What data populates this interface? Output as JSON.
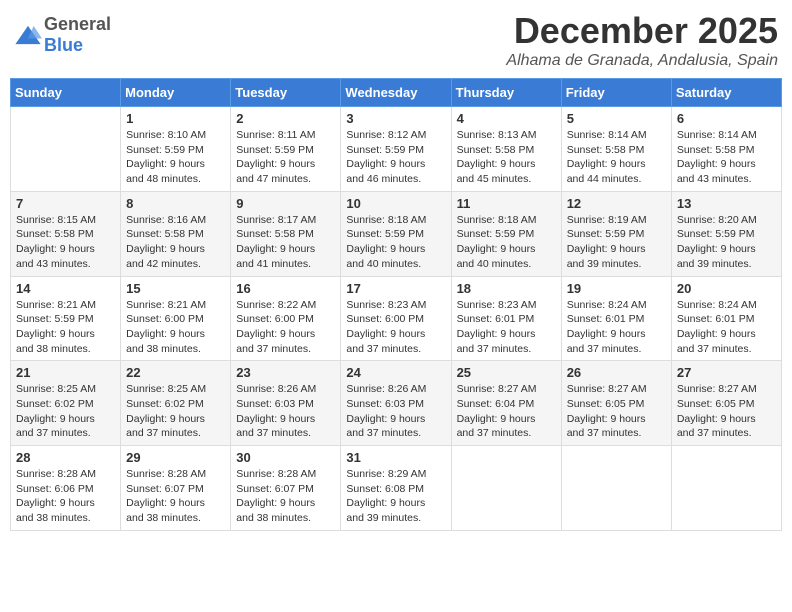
{
  "logo": {
    "general": "General",
    "blue": "Blue"
  },
  "title": "December 2025",
  "subtitle": "Alhama de Granada, Andalusia, Spain",
  "headers": [
    "Sunday",
    "Monday",
    "Tuesday",
    "Wednesday",
    "Thursday",
    "Friday",
    "Saturday"
  ],
  "weeks": [
    [
      {
        "day": "",
        "sunrise": "",
        "sunset": "",
        "daylight": ""
      },
      {
        "day": "1",
        "sunrise": "Sunrise: 8:10 AM",
        "sunset": "Sunset: 5:59 PM",
        "daylight": "Daylight: 9 hours and 48 minutes."
      },
      {
        "day": "2",
        "sunrise": "Sunrise: 8:11 AM",
        "sunset": "Sunset: 5:59 PM",
        "daylight": "Daylight: 9 hours and 47 minutes."
      },
      {
        "day": "3",
        "sunrise": "Sunrise: 8:12 AM",
        "sunset": "Sunset: 5:59 PM",
        "daylight": "Daylight: 9 hours and 46 minutes."
      },
      {
        "day": "4",
        "sunrise": "Sunrise: 8:13 AM",
        "sunset": "Sunset: 5:58 PM",
        "daylight": "Daylight: 9 hours and 45 minutes."
      },
      {
        "day": "5",
        "sunrise": "Sunrise: 8:14 AM",
        "sunset": "Sunset: 5:58 PM",
        "daylight": "Daylight: 9 hours and 44 minutes."
      },
      {
        "day": "6",
        "sunrise": "Sunrise: 8:14 AM",
        "sunset": "Sunset: 5:58 PM",
        "daylight": "Daylight: 9 hours and 43 minutes."
      }
    ],
    [
      {
        "day": "7",
        "sunrise": "Sunrise: 8:15 AM",
        "sunset": "Sunset: 5:58 PM",
        "daylight": "Daylight: 9 hours and 43 minutes."
      },
      {
        "day": "8",
        "sunrise": "Sunrise: 8:16 AM",
        "sunset": "Sunset: 5:58 PM",
        "daylight": "Daylight: 9 hours and 42 minutes."
      },
      {
        "day": "9",
        "sunrise": "Sunrise: 8:17 AM",
        "sunset": "Sunset: 5:58 PM",
        "daylight": "Daylight: 9 hours and 41 minutes."
      },
      {
        "day": "10",
        "sunrise": "Sunrise: 8:18 AM",
        "sunset": "Sunset: 5:59 PM",
        "daylight": "Daylight: 9 hours and 40 minutes."
      },
      {
        "day": "11",
        "sunrise": "Sunrise: 8:18 AM",
        "sunset": "Sunset: 5:59 PM",
        "daylight": "Daylight: 9 hours and 40 minutes."
      },
      {
        "day": "12",
        "sunrise": "Sunrise: 8:19 AM",
        "sunset": "Sunset: 5:59 PM",
        "daylight": "Daylight: 9 hours and 39 minutes."
      },
      {
        "day": "13",
        "sunrise": "Sunrise: 8:20 AM",
        "sunset": "Sunset: 5:59 PM",
        "daylight": "Daylight: 9 hours and 39 minutes."
      }
    ],
    [
      {
        "day": "14",
        "sunrise": "Sunrise: 8:21 AM",
        "sunset": "Sunset: 5:59 PM",
        "daylight": "Daylight: 9 hours and 38 minutes."
      },
      {
        "day": "15",
        "sunrise": "Sunrise: 8:21 AM",
        "sunset": "Sunset: 6:00 PM",
        "daylight": "Daylight: 9 hours and 38 minutes."
      },
      {
        "day": "16",
        "sunrise": "Sunrise: 8:22 AM",
        "sunset": "Sunset: 6:00 PM",
        "daylight": "Daylight: 9 hours and 37 minutes."
      },
      {
        "day": "17",
        "sunrise": "Sunrise: 8:23 AM",
        "sunset": "Sunset: 6:00 PM",
        "daylight": "Daylight: 9 hours and 37 minutes."
      },
      {
        "day": "18",
        "sunrise": "Sunrise: 8:23 AM",
        "sunset": "Sunset: 6:01 PM",
        "daylight": "Daylight: 9 hours and 37 minutes."
      },
      {
        "day": "19",
        "sunrise": "Sunrise: 8:24 AM",
        "sunset": "Sunset: 6:01 PM",
        "daylight": "Daylight: 9 hours and 37 minutes."
      },
      {
        "day": "20",
        "sunrise": "Sunrise: 8:24 AM",
        "sunset": "Sunset: 6:01 PM",
        "daylight": "Daylight: 9 hours and 37 minutes."
      }
    ],
    [
      {
        "day": "21",
        "sunrise": "Sunrise: 8:25 AM",
        "sunset": "Sunset: 6:02 PM",
        "daylight": "Daylight: 9 hours and 37 minutes."
      },
      {
        "day": "22",
        "sunrise": "Sunrise: 8:25 AM",
        "sunset": "Sunset: 6:02 PM",
        "daylight": "Daylight: 9 hours and 37 minutes."
      },
      {
        "day": "23",
        "sunrise": "Sunrise: 8:26 AM",
        "sunset": "Sunset: 6:03 PM",
        "daylight": "Daylight: 9 hours and 37 minutes."
      },
      {
        "day": "24",
        "sunrise": "Sunrise: 8:26 AM",
        "sunset": "Sunset: 6:03 PM",
        "daylight": "Daylight: 9 hours and 37 minutes."
      },
      {
        "day": "25",
        "sunrise": "Sunrise: 8:27 AM",
        "sunset": "Sunset: 6:04 PM",
        "daylight": "Daylight: 9 hours and 37 minutes."
      },
      {
        "day": "26",
        "sunrise": "Sunrise: 8:27 AM",
        "sunset": "Sunset: 6:05 PM",
        "daylight": "Daylight: 9 hours and 37 minutes."
      },
      {
        "day": "27",
        "sunrise": "Sunrise: 8:27 AM",
        "sunset": "Sunset: 6:05 PM",
        "daylight": "Daylight: 9 hours and 37 minutes."
      }
    ],
    [
      {
        "day": "28",
        "sunrise": "Sunrise: 8:28 AM",
        "sunset": "Sunset: 6:06 PM",
        "daylight": "Daylight: 9 hours and 38 minutes."
      },
      {
        "day": "29",
        "sunrise": "Sunrise: 8:28 AM",
        "sunset": "Sunset: 6:07 PM",
        "daylight": "Daylight: 9 hours and 38 minutes."
      },
      {
        "day": "30",
        "sunrise": "Sunrise: 8:28 AM",
        "sunset": "Sunset: 6:07 PM",
        "daylight": "Daylight: 9 hours and 38 minutes."
      },
      {
        "day": "31",
        "sunrise": "Sunrise: 8:29 AM",
        "sunset": "Sunset: 6:08 PM",
        "daylight": "Daylight: 9 hours and 39 minutes."
      },
      {
        "day": "",
        "sunrise": "",
        "sunset": "",
        "daylight": ""
      },
      {
        "day": "",
        "sunrise": "",
        "sunset": "",
        "daylight": ""
      },
      {
        "day": "",
        "sunrise": "",
        "sunset": "",
        "daylight": ""
      }
    ]
  ]
}
